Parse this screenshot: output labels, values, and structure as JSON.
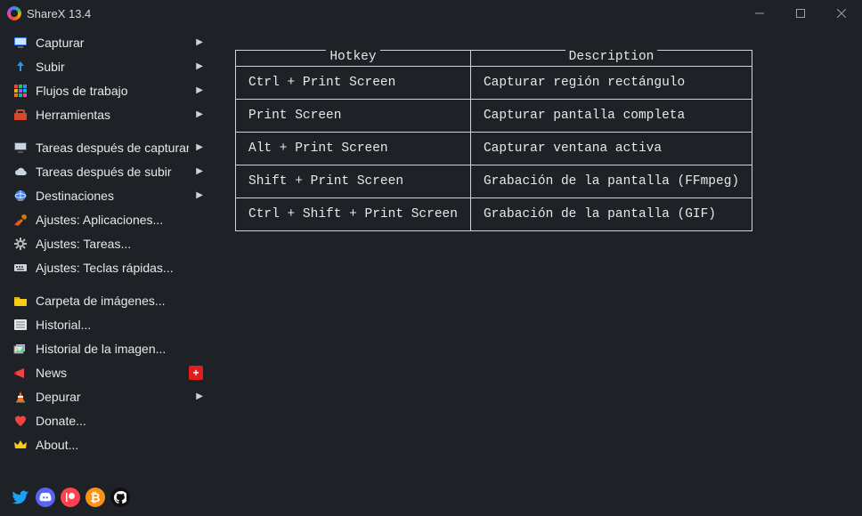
{
  "titlebar": {
    "title": "ShareX 13.4"
  },
  "sidebar": {
    "groups": [
      [
        {
          "id": "capture",
          "label": "Capturar",
          "arrow": true,
          "icon": "monitor"
        },
        {
          "id": "upload",
          "label": "Subir",
          "arrow": true,
          "icon": "upload"
        },
        {
          "id": "workflows",
          "label": "Flujos de trabajo",
          "arrow": true,
          "icon": "grid"
        },
        {
          "id": "tools",
          "label": "Herramientas",
          "arrow": true,
          "icon": "toolbox"
        }
      ],
      [
        {
          "id": "after-capture",
          "label": "Tareas después de capturar",
          "arrow": true,
          "icon": "monitor-small"
        },
        {
          "id": "after-upload",
          "label": "Tareas después de subir",
          "arrow": true,
          "icon": "cloud"
        },
        {
          "id": "destinations",
          "label": "Destinaciones",
          "arrow": true,
          "icon": "globe"
        },
        {
          "id": "app-settings",
          "label": "Ajustes: Aplicaciones...",
          "arrow": false,
          "icon": "wrench"
        },
        {
          "id": "task-settings",
          "label": "Ajustes: Tareas...",
          "arrow": false,
          "icon": "gear"
        },
        {
          "id": "hotkey-settings",
          "label": "Ajustes: Teclas rápidas...",
          "arrow": false,
          "icon": "keyboard"
        }
      ],
      [
        {
          "id": "img-folder",
          "label": "Carpeta de imágenes...",
          "arrow": false,
          "icon": "folder"
        },
        {
          "id": "history",
          "label": "Historial...",
          "arrow": false,
          "icon": "list"
        },
        {
          "id": "img-history",
          "label": "Historial de la imagen...",
          "arrow": false,
          "icon": "images"
        },
        {
          "id": "news",
          "label": "News",
          "arrow": false,
          "icon": "megaphone",
          "badge": "+"
        },
        {
          "id": "debug",
          "label": "Depurar",
          "arrow": true,
          "icon": "cone"
        },
        {
          "id": "donate",
          "label": "Donate...",
          "arrow": false,
          "icon": "heart"
        },
        {
          "id": "about",
          "label": "About...",
          "arrow": false,
          "icon": "crown"
        }
      ]
    ]
  },
  "social": [
    {
      "id": "twitter",
      "name": "twitter-icon"
    },
    {
      "id": "discord",
      "name": "discord-icon"
    },
    {
      "id": "patreon",
      "name": "patreon-icon"
    },
    {
      "id": "bitcoin",
      "name": "bitcoin-icon"
    },
    {
      "id": "github",
      "name": "github-icon"
    }
  ],
  "hotkeys": {
    "headers": {
      "hotkey": "Hotkey",
      "description": "Description"
    },
    "rows": [
      {
        "hotkey": "Ctrl + Print Screen",
        "desc": "Capturar región rectángulo"
      },
      {
        "hotkey": "Print Screen",
        "desc": "Capturar pantalla completa"
      },
      {
        "hotkey": "Alt + Print Screen",
        "desc": "Capturar ventana activa"
      },
      {
        "hotkey": "Shift + Print Screen",
        "desc": "Grabación de la pantalla (FFmpeg)"
      },
      {
        "hotkey": "Ctrl + Shift + Print Screen",
        "desc": "Grabación de la pantalla (GIF)"
      }
    ]
  }
}
